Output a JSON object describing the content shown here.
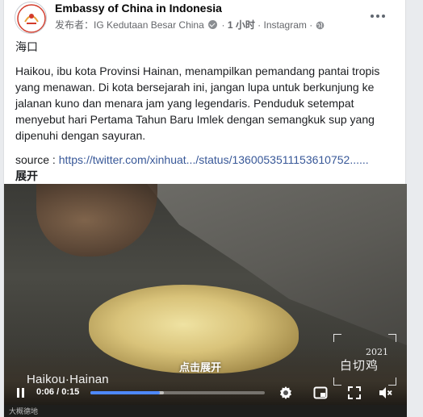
{
  "post": {
    "page_name": "Embassy of China in Indonesia",
    "meta_prefix": "发布者：",
    "author": "IG Kedutaan Besar China",
    "time": "1 小时",
    "source_platform": "Instagram",
    "title": "海口",
    "paragraph": "Haikou, ibu kota Provinsi Hainan, menampilkan pemandang pantai tropis yang menawan. Di kota bersejarah ini, jangan lupa untuk berkunjung ke jalanan kuno dan menara jam yang legendaris. Penduduk setempat menyebut hari Pertama Tahun Baru Imlek dengan semangkuk sup yang dipenuhi dengan sayuran.",
    "source_label": "source : ",
    "source_url": "https://twitter.com/xinhuat.../status/1360053511153610752......",
    "expand_label": "展开"
  },
  "video": {
    "watermark": "Haikou·Hainan",
    "click_expand": "点击展开",
    "overlay_year": "2021",
    "overlay_dish": "白切鸡",
    "time_current": "0:06",
    "time_total": "0:15",
    "progress_fraction": 0.4,
    "buffer_fraction": 0.42,
    "accent_color": "#4e89ff",
    "logo_text": "大概德地"
  },
  "icons": {
    "more": "more-horizontal-icon",
    "verified": "verified-badge-icon",
    "globe": "globe-icon",
    "pause": "pause-icon",
    "settings": "gear-icon",
    "pip": "picture-in-picture-icon",
    "fullscreen": "fullscreen-icon",
    "volume": "volume-muted-icon"
  }
}
